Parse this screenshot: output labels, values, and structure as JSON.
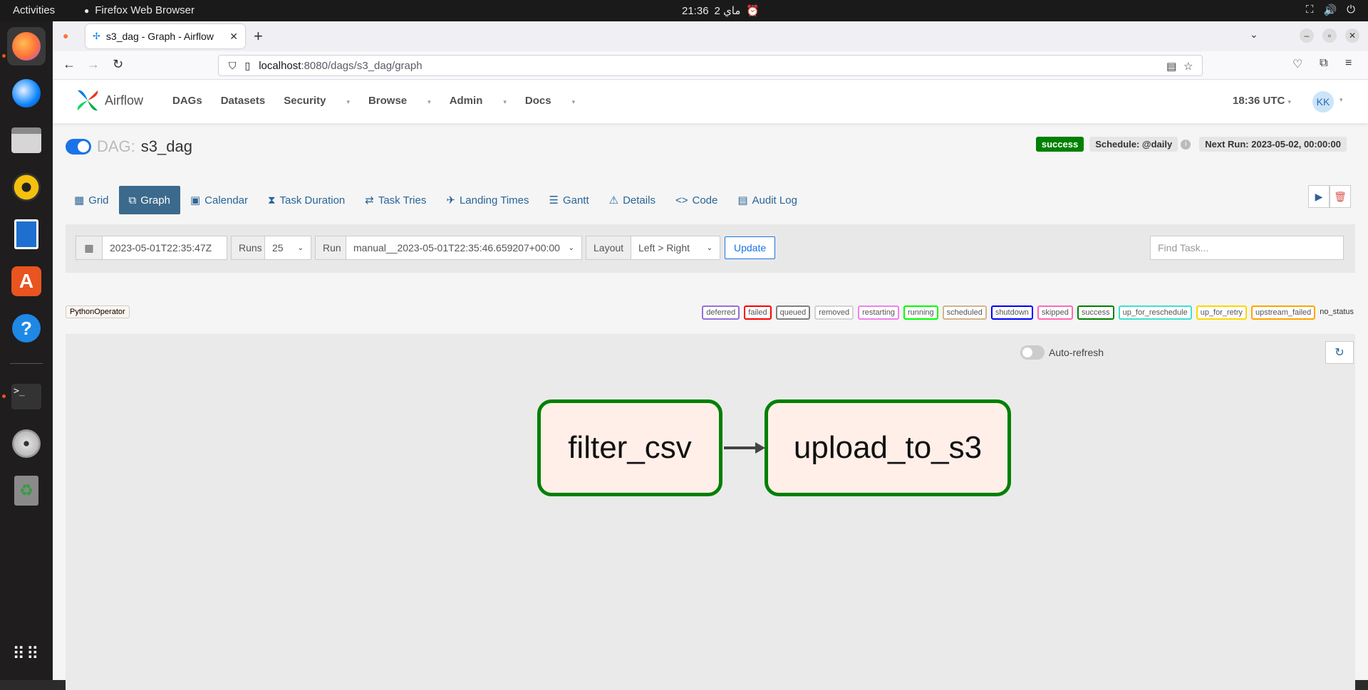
{
  "os": {
    "activities": "Activities",
    "app_name": "Firefox Web Browser",
    "clock_time": "21:36",
    "clock_date": "2 ماي"
  },
  "browser": {
    "tab_title": "s3_dag - Graph - Airflow",
    "url_host": "localhost",
    "url_path": ":8080/dags/s3_dag/graph"
  },
  "airflow": {
    "brand": "Airflow",
    "menu": [
      "DAGs",
      "Datasets",
      "Security",
      "Browse",
      "Admin",
      "Docs"
    ],
    "time": "18:36 UTC",
    "avatar": "KK",
    "dag_label": "DAG:",
    "dag_id": "s3_dag",
    "status": "success",
    "schedule": "Schedule: @daily",
    "next_run": "Next Run: 2023-05-02, 00:00:00",
    "tabs": [
      "Grid",
      "Graph",
      "Calendar",
      "Task Duration",
      "Task Tries",
      "Landing Times",
      "Gantt",
      "Details",
      "Code",
      "Audit Log"
    ],
    "filters": {
      "base_date": "2023-05-01T22:35:47Z",
      "runs_label": "Runs",
      "runs_value": "25",
      "run_label": "Run",
      "run_value": "manual__2023-05-01T22:35:46.659207+00:00",
      "layout_label": "Layout",
      "layout_value": "Left > Right",
      "update": "Update",
      "find_placeholder": "Find Task..."
    },
    "operator": "PythonOperator",
    "states": [
      {
        "label": "deferred",
        "color": "#9370db"
      },
      {
        "label": "failed",
        "color": "#ff0000"
      },
      {
        "label": "queued",
        "color": "#808080"
      },
      {
        "label": "removed",
        "color": "#d3d3d3"
      },
      {
        "label": "restarting",
        "color": "#ee82ee"
      },
      {
        "label": "running",
        "color": "#00ff00"
      },
      {
        "label": "scheduled",
        "color": "#d2b48c"
      },
      {
        "label": "shutdown",
        "color": "#0000ff"
      },
      {
        "label": "skipped",
        "color": "#ff69b4"
      },
      {
        "label": "success",
        "color": "#008000"
      },
      {
        "label": "up_for_reschedule",
        "color": "#40e0d0"
      },
      {
        "label": "up_for_retry",
        "color": "#ffd700"
      },
      {
        "label": "upstream_failed",
        "color": "#ffa500"
      }
    ],
    "no_status": "no_status",
    "auto_refresh": "Auto-refresh",
    "nodes": [
      "filter_csv",
      "upload_to_s3"
    ]
  }
}
